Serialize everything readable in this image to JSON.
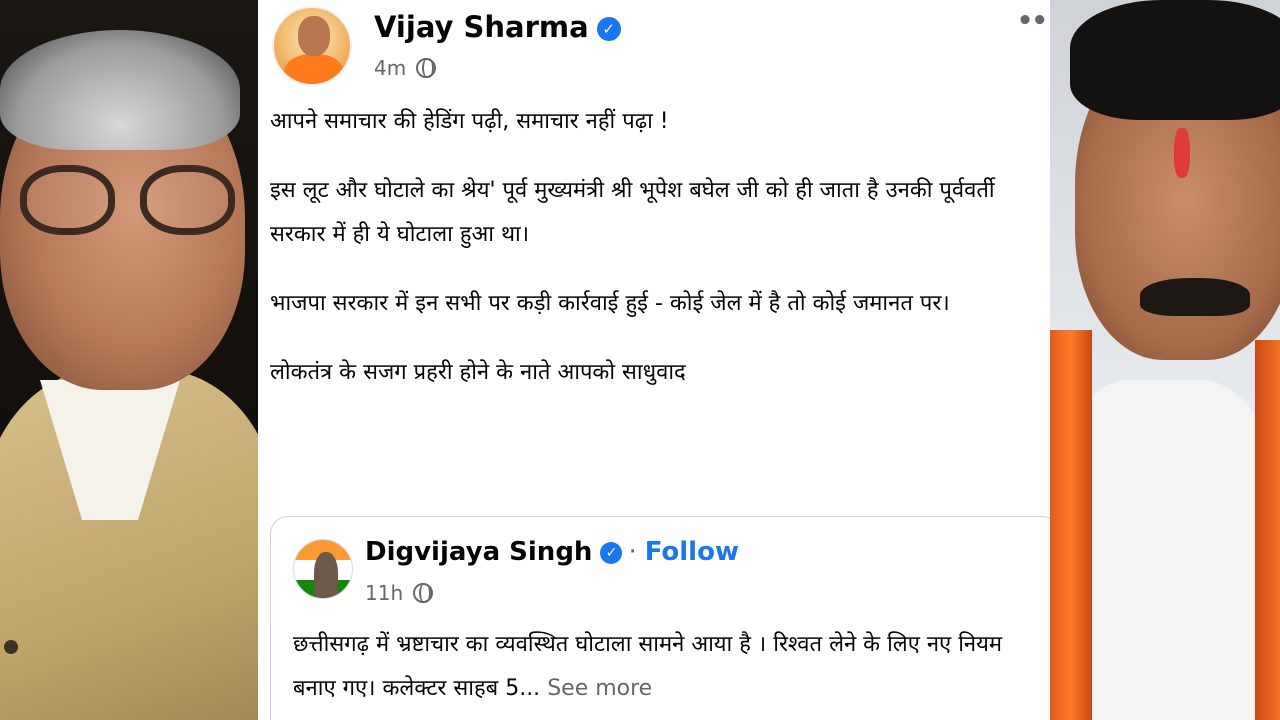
{
  "post": {
    "author": "Vijay Sharma",
    "time": "4m",
    "more_label": "••",
    "paragraphs": [
      "आपने समाचार की हेडिंग पढ़ी, समाचार नहीं पढ़ा !",
      "इस लूट और घोटाले का श्रेय' पूर्व मुख्यमंत्री श्री भूपेश बघेल जी को ही जाता है उनकी पूर्ववर्ती सरकार में ही ये घोटाला हुआ था।",
      "भाजपा सरकार में इन सभी पर कड़ी कार्रवाई हुई - कोई जेल में है तो कोई जमानत पर।",
      "लोकतंत्र के सजग प्रहरी होने के नाते आपको साधुवाद"
    ]
  },
  "shared_post": {
    "author": "Digvijaya Singh",
    "separator": "·",
    "follow_label": "Follow",
    "time": "11h",
    "text": "छत्तीसगढ़ में भ्रष्टाचार का व्यवस्थित घोटाला सामने आया है । रिश्वत लेने के लिए नए नियम बनाए गए। कलेक्टर साहब 5...",
    "see_more_label": "See more"
  },
  "icons": {
    "verified": "verified-badge-icon",
    "privacy": "globe-icon",
    "more": "more-options-icon"
  },
  "colors": {
    "accent": "#1877f2",
    "meta_text": "#65676b",
    "body_text": "#050505"
  }
}
